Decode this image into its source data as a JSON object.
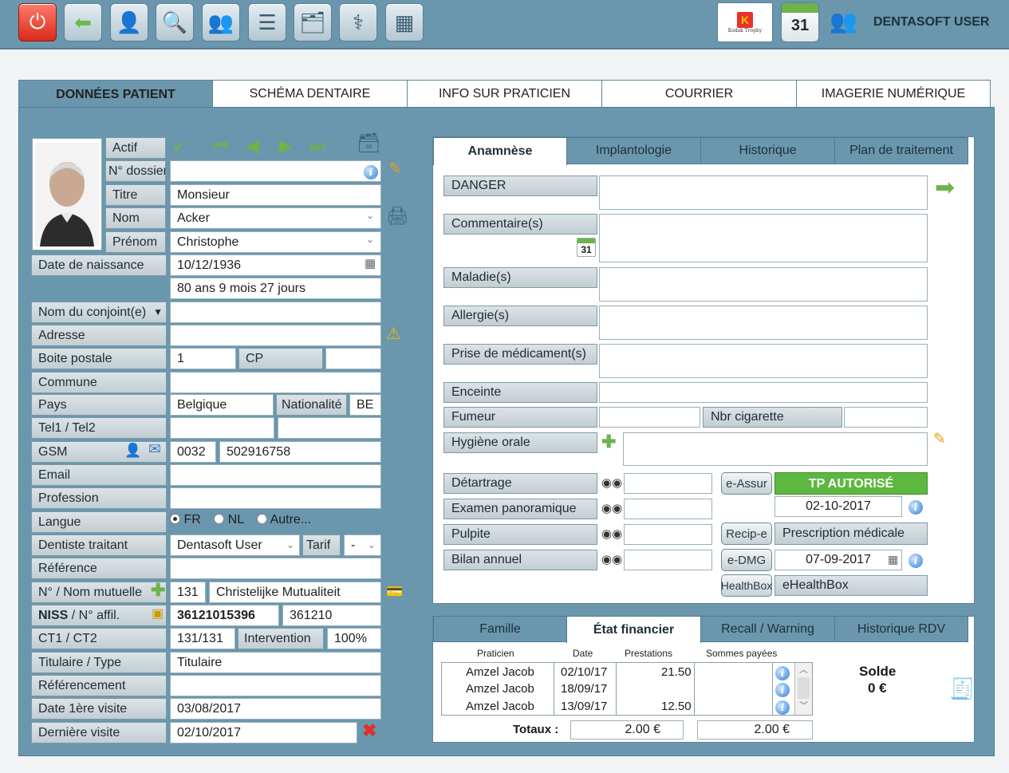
{
  "toolbar": {
    "icons": [
      "power-icon",
      "back-arrow-icon",
      "patient-icon",
      "search-icon",
      "group-icon",
      "list-icon",
      "documents-icon",
      "doctor-icon",
      "calendar-sheet-icon"
    ],
    "kodak_label": "Kodak Trophy",
    "calendar_day": "31",
    "user": "DENTASOFT USER"
  },
  "tabs": [
    "DONNÉES PATIENT",
    "SCHÉMA DENTAIRE",
    "INFO SUR PRATICIEN",
    "COURRIER",
    "IMAGERIE NUMÉRIQUE"
  ],
  "patient": {
    "actif_label": "Actif",
    "dossier_label": "N° dossier",
    "dossier_value": "",
    "titre_label": "Titre",
    "titre_value": "Monsieur",
    "nom_label": "Nom",
    "nom_value": "Acker",
    "prenom_label": "Prénom",
    "prenom_value": "Christophe",
    "dob_label": "Date de naissance",
    "dob_value": "10/12/1936",
    "age_value": "80 ans 9 mois 27 jours",
    "conjoint_label": "Nom du conjoint(e)",
    "adresse_label": "Adresse",
    "boite_label": "Boite postale",
    "boite_value": "1",
    "cp_label": "CP",
    "commune_label": "Commune",
    "pays_label": "Pays",
    "pays_value": "Belgique",
    "nationalite_label": "Nationalité",
    "nationalite_value": "BE",
    "tel_label": "Tel1 / Tel2",
    "gsm_label": "GSM",
    "gsm_prefix": "0032",
    "gsm_value": "502916758",
    "email_label": "Email",
    "profession_label": "Profession",
    "langue_label": "Langue",
    "langue_options": [
      "FR",
      "NL",
      "Autre..."
    ],
    "dentiste_label": "Dentiste traitant",
    "dentiste_value": "Dentasoft User",
    "tarif_label": "Tarif",
    "tarif_value": "-",
    "reference_label": "Référence",
    "mutuelle_label": "N° / Nom mutuelle",
    "mutuelle_num": "131",
    "mutuelle_name": "Christelijke Mutualiteit",
    "niss_label_bold": "NISS",
    "niss_label_rest": " / N° affil.",
    "niss_value": "36121015396",
    "affil_value": "361210",
    "ct_label": "CT1 / CT2",
    "ct_value": "131/131",
    "intervention_label": "Intervention",
    "intervention_value": "100%",
    "titulaire_label": "Titulaire / Type",
    "titulaire_value": "Titulaire",
    "referencement_label": "Référencement",
    "premiere_label": "Date 1ère visite",
    "premiere_value": "03/08/2017",
    "derniere_label": "Dernière visite",
    "derniere_value": "02/10/2017"
  },
  "subtabs": [
    "Anamnèse",
    "Implantologie",
    "Historique",
    "Plan de traitement"
  ],
  "anamnese": {
    "danger": "DANGER",
    "commentaires": "Commentaire(s)",
    "calendar_day": "31",
    "maladies": "Maladie(s)",
    "allergies": "Allergie(s)",
    "medicaments": "Prise de médicament(s)",
    "enceinte": "Enceinte",
    "fumeur": "Fumeur",
    "nbr_cigarette": "Nbr cigarette",
    "hygiene": "Hygiène orale",
    "detartrage": "Détartrage",
    "examen": "Examen panoramique",
    "pulpite": "Pulpite",
    "bilan": "Bilan annuel",
    "eassur": "e-Assur",
    "tp_autorise": "TP AUTORISÉ",
    "tp_date": "02-10-2017",
    "recip": "Recip-e",
    "prescription": "Prescription médicale",
    "dmg": "e-DMG",
    "dmg_date": "07-09-2017",
    "healthbox_btn": "HealthBox",
    "ehealthbox": "eHealthBox",
    "tp_color": "#5cb83e"
  },
  "fin_tabs": [
    "Famille",
    "État financier",
    "Recall / Warning",
    "Historique RDV"
  ],
  "finance": {
    "headers": [
      "Praticien",
      "Date",
      "Prestations",
      "Sommes payées"
    ],
    "rows": [
      {
        "praticien": "Amzel Jacob",
        "date": "02/10/17",
        "prestations": "21.50",
        "sommes": ""
      },
      {
        "praticien": "Amzel Jacob",
        "date": "18/09/17",
        "prestations": "",
        "sommes": ""
      },
      {
        "praticien": "Amzel Jacob",
        "date": "13/09/17",
        "prestations": "12.50",
        "sommes": ""
      }
    ],
    "totaux_label": "Totaux :",
    "total_prestations": "2.00 €",
    "total_sommes": "2.00 €",
    "solde_label": "Solde",
    "solde_value": "0 €"
  }
}
